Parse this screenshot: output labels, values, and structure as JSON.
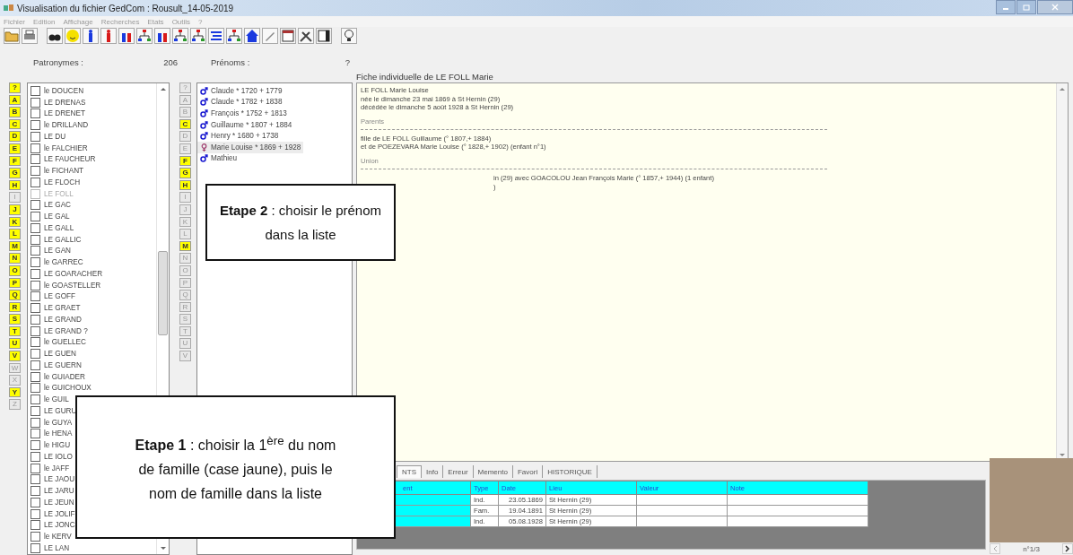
{
  "window": {
    "title": "Visualisation du fichier GedCom : Rousult_14-05-2019"
  },
  "menu": [
    "Fichier",
    "Edition",
    "Affichage",
    "Recherches",
    "Etats",
    "Outils",
    "?"
  ],
  "patronymes": {
    "label": "Patronymes :",
    "count": "206",
    "letters": [
      {
        "label": "?",
        "available": true
      },
      {
        "label": "A",
        "available": true
      },
      {
        "label": "B",
        "available": true
      },
      {
        "label": "C",
        "available": true
      },
      {
        "label": "D",
        "available": true
      },
      {
        "label": "E",
        "available": true
      },
      {
        "label": "F",
        "available": true
      },
      {
        "label": "G",
        "available": true
      },
      {
        "label": "H",
        "available": true
      },
      {
        "label": "I",
        "available": false
      },
      {
        "label": "J",
        "available": true
      },
      {
        "label": "K",
        "available": true
      },
      {
        "label": "L",
        "available": true
      },
      {
        "label": "M",
        "available": true
      },
      {
        "label": "N",
        "available": true
      },
      {
        "label": "O",
        "available": true
      },
      {
        "label": "P",
        "available": true
      },
      {
        "label": "Q",
        "available": true
      },
      {
        "label": "R",
        "available": true
      },
      {
        "label": "S",
        "available": true
      },
      {
        "label": "T",
        "available": true
      },
      {
        "label": "U",
        "available": true
      },
      {
        "label": "V",
        "available": true
      },
      {
        "label": "W",
        "available": false
      },
      {
        "label": "X",
        "available": false
      },
      {
        "label": "Y",
        "available": true
      },
      {
        "label": "Z",
        "available": false
      }
    ],
    "items": [
      {
        "name": "le DOUCEN",
        "checked": false,
        "selected": false
      },
      {
        "name": "LE DRENAS",
        "checked": false,
        "selected": false
      },
      {
        "name": "LE DRENET",
        "checked": false,
        "selected": false
      },
      {
        "name": "le DRILLAND",
        "checked": false,
        "selected": false
      },
      {
        "name": "LE DU",
        "checked": false,
        "selected": false
      },
      {
        "name": "le FALCHIER",
        "checked": false,
        "selected": false
      },
      {
        "name": "LE FAUCHEUR",
        "checked": false,
        "selected": false
      },
      {
        "name": "le FICHANT",
        "checked": false,
        "selected": false
      },
      {
        "name": "LE FLOCH",
        "checked": false,
        "selected": false
      },
      {
        "name": "LE FOLL",
        "checked": false,
        "selected": true
      },
      {
        "name": "LE GAC",
        "checked": false,
        "selected": false
      },
      {
        "name": "LE GAL",
        "checked": false,
        "selected": false
      },
      {
        "name": "LE GALL",
        "checked": false,
        "selected": false
      },
      {
        "name": "LE GALLIC",
        "checked": false,
        "selected": false
      },
      {
        "name": "LE GAN",
        "checked": false,
        "selected": false
      },
      {
        "name": "le GARREC",
        "checked": false,
        "selected": false
      },
      {
        "name": "LE GOARACHER",
        "checked": false,
        "selected": false
      },
      {
        "name": "le GOASTELLER",
        "checked": false,
        "selected": false
      },
      {
        "name": "LE GOFF",
        "checked": false,
        "selected": false
      },
      {
        "name": "LE GRAET",
        "checked": false,
        "selected": false
      },
      {
        "name": "LE GRAND",
        "checked": false,
        "selected": false
      },
      {
        "name": "LE GRAND ?",
        "checked": false,
        "selected": false
      },
      {
        "name": "le GUELLEC",
        "checked": false,
        "selected": false
      },
      {
        "name": "LE GUEN",
        "checked": false,
        "selected": false
      },
      {
        "name": "LE GUERN",
        "checked": false,
        "selected": false
      },
      {
        "name": "le GUIADER",
        "checked": false,
        "selected": false
      },
      {
        "name": "le GUICHOUX",
        "checked": false,
        "selected": false
      },
      {
        "name": "le GUIL",
        "checked": false,
        "selected": false
      },
      {
        "name": "LE GURU",
        "checked": false,
        "selected": false
      },
      {
        "name": "le GUYA",
        "checked": false,
        "selected": false
      },
      {
        "name": "le HENA",
        "checked": false,
        "selected": false
      },
      {
        "name": "le HIGU",
        "checked": false,
        "selected": false
      },
      {
        "name": "LE IOLO",
        "checked": false,
        "selected": false
      },
      {
        "name": "le JAFF",
        "checked": false,
        "selected": false
      },
      {
        "name": "LE JAOU",
        "checked": false,
        "selected": false
      },
      {
        "name": "LE JARU",
        "checked": false,
        "selected": false
      },
      {
        "name": "LE JEUN",
        "checked": false,
        "selected": false
      },
      {
        "name": "LE JOLIF",
        "checked": false,
        "selected": false
      },
      {
        "name": "LE JONC",
        "checked": false,
        "selected": false
      },
      {
        "name": "le KERV",
        "checked": false,
        "selected": false
      },
      {
        "name": "LE LAN",
        "checked": false,
        "selected": false
      }
    ]
  },
  "prenoms": {
    "label": "Prénoms :",
    "count": "?",
    "letters": [
      {
        "label": "?",
        "available": false
      },
      {
        "label": "A",
        "available": false
      },
      {
        "label": "B",
        "available": false
      },
      {
        "label": "C",
        "available": true
      },
      {
        "label": "D",
        "available": false
      },
      {
        "label": "E",
        "available": false
      },
      {
        "label": "F",
        "available": true
      },
      {
        "label": "G",
        "available": true
      },
      {
        "label": "H",
        "available": true
      },
      {
        "label": "I",
        "available": false
      },
      {
        "label": "J",
        "available": false
      },
      {
        "label": "K",
        "available": false
      },
      {
        "label": "L",
        "available": false
      },
      {
        "label": "M",
        "available": true
      },
      {
        "label": "N",
        "available": false
      },
      {
        "label": "O",
        "available": false
      },
      {
        "label": "P",
        "available": false
      },
      {
        "label": "Q",
        "available": false
      },
      {
        "label": "R",
        "available": false
      },
      {
        "label": "S",
        "available": false
      },
      {
        "label": "T",
        "available": false
      },
      {
        "label": "U",
        "available": false
      },
      {
        "label": "V",
        "available": false
      }
    ],
    "items": [
      {
        "kind": "male",
        "name": "Claude * 1720 + 1779",
        "selected": false
      },
      {
        "kind": "male",
        "name": "Claude * 1782 + 1838",
        "selected": false
      },
      {
        "kind": "male",
        "name": "François * 1752 + 1813",
        "selected": false
      },
      {
        "kind": "male",
        "name": "Guillaume * 1807 + 1884",
        "selected": false
      },
      {
        "kind": "male",
        "name": "Henry * 1680 + 1738",
        "selected": false
      },
      {
        "kind": "female",
        "name": "Marie Louise * 1869 + 1928",
        "selected": true
      },
      {
        "kind": "male",
        "name": "Mathieu",
        "selected": false
      }
    ]
  },
  "fiche": {
    "title": "Fiche individuelle de LE FOLL Marie",
    "blocks": [
      {
        "kind": "text",
        "lines": [
          "LE FOLL Marie Louise",
          "née le dimanche 23 mai 1869 à St Hernin (29)",
          "décédée le dimanche 5 août 1928 à St Hernin (29)"
        ]
      },
      {
        "kind": "heading",
        "text": "Parents"
      },
      {
        "kind": "rule"
      },
      {
        "kind": "text",
        "lines": [
          "fille de LE FOLL Guillaume (° 1807,+  1884)",
          "et de POEZEVARA Marie Louise (° 1828,+  1902) (enfant n°1)"
        ]
      },
      {
        "kind": "heading",
        "text": "Union"
      },
      {
        "kind": "rule"
      },
      {
        "kind": "partial",
        "lines": [
          "in (29) avec GOACOLOU Jean François Marie (° 1857,+  1944) (1 enfant)",
          ")"
        ]
      }
    ]
  },
  "tabs": [
    {
      "label": "NTS",
      "selected": true
    },
    {
      "label": "Info",
      "selected": false
    },
    {
      "label": "Erreur",
      "selected": false
    },
    {
      "label": "Memento",
      "selected": false
    },
    {
      "label": "Favori",
      "selected": false
    },
    {
      "label": "HISTORIQUE",
      "selected": false
    }
  ],
  "table": {
    "columns": [
      "ent",
      "Type",
      "Date",
      "Lieu",
      "Valeur",
      "Note"
    ],
    "rows": [
      [
        "",
        "Ind.",
        "23.05.1869",
        "St Hernin (29)",
        "",
        ""
      ],
      [
        "",
        "Fam.",
        "19.04.1891",
        "St Hernin (29)",
        "",
        ""
      ],
      [
        "",
        "Ind.",
        "05.08.1928",
        "St Hernin (29)",
        "",
        ""
      ]
    ]
  },
  "photo": {
    "counter": "n°1/3"
  },
  "callouts": [
    {
      "text": "**Etape 2** : choisir le prénom dans la liste"
    },
    {
      "text": "**Etape 1** : choisir la 1$^{ère}$ du nom de famille (case jaune), puis le nom de famille dans la liste"
    }
  ]
}
